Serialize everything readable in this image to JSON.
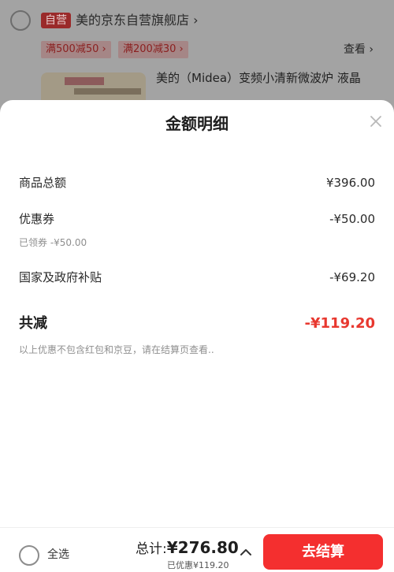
{
  "cart": {
    "store_badge": "自营",
    "store_name": "美的京东自营旗舰店 ›",
    "promos": [
      "满500减50 ›",
      "满200减30 ›"
    ],
    "view_link": "查看 ›",
    "product_title": "美的（Midea）变频小清新微波炉 液晶"
  },
  "sheet": {
    "title": "金额明细",
    "rows": [
      {
        "label": "商品总额",
        "value": "¥396.00"
      },
      {
        "label": "优惠券",
        "value": "-¥50.00",
        "sub": "已领券 -¥50.00"
      },
      {
        "label": "国家及政府补贴",
        "value": "-¥69.20"
      }
    ],
    "total_label": "共减",
    "total_value": "-¥119.20",
    "note": "以上优惠不包含红包和京豆，请在结算页查看.."
  },
  "bottom": {
    "select_all": "全选",
    "sum_prefix": "总计:",
    "sum_amount": "¥276.80",
    "saved": "已优惠¥119.20",
    "checkout": "去结算"
  },
  "colors": {
    "accent": "#f42f2f",
    "total_red": "#e8382f"
  }
}
